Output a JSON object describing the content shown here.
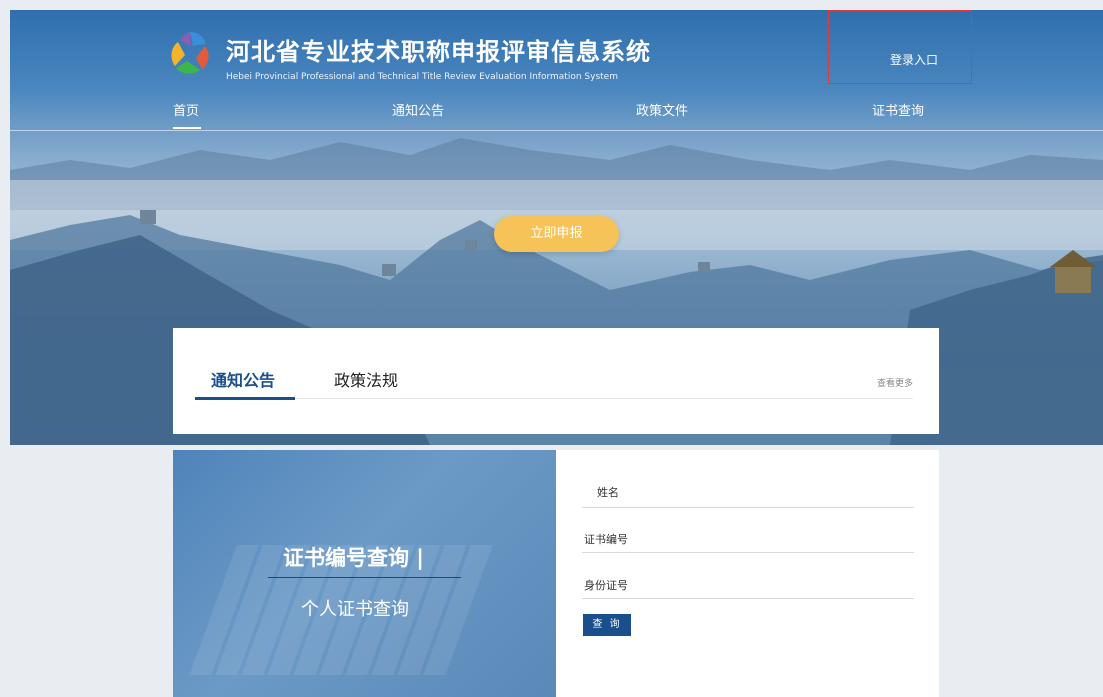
{
  "header": {
    "title": "河北省专业技术职称申报评审信息系统",
    "subtitle": "Hebei Provincial Professional and Technical Title Review Evaluation Information System",
    "login_label": "登录入口"
  },
  "nav": {
    "items": [
      {
        "label": "首页",
        "active": true
      },
      {
        "label": "通知公告",
        "active": false
      },
      {
        "label": "政策文件",
        "active": false
      },
      {
        "label": "证书查询",
        "active": false
      }
    ]
  },
  "hero": {
    "apply_label": "立即申报"
  },
  "notice_panel": {
    "tabs": [
      {
        "label": "通知公告",
        "active": true
      },
      {
        "label": "政策法规",
        "active": false
      }
    ],
    "more_label": "查看更多"
  },
  "certificate": {
    "title": "证书编号查询 |",
    "subtitle": "个人证书查询",
    "fields": [
      {
        "label": "姓名"
      },
      {
        "label": "证书编号"
      },
      {
        "label": "身份证号"
      }
    ],
    "query_label": "查 询"
  },
  "colors": {
    "brand_blue": "#1b4f8c",
    "apply_yellow": "#f6c358",
    "highlight_red": "#e03a3a"
  }
}
